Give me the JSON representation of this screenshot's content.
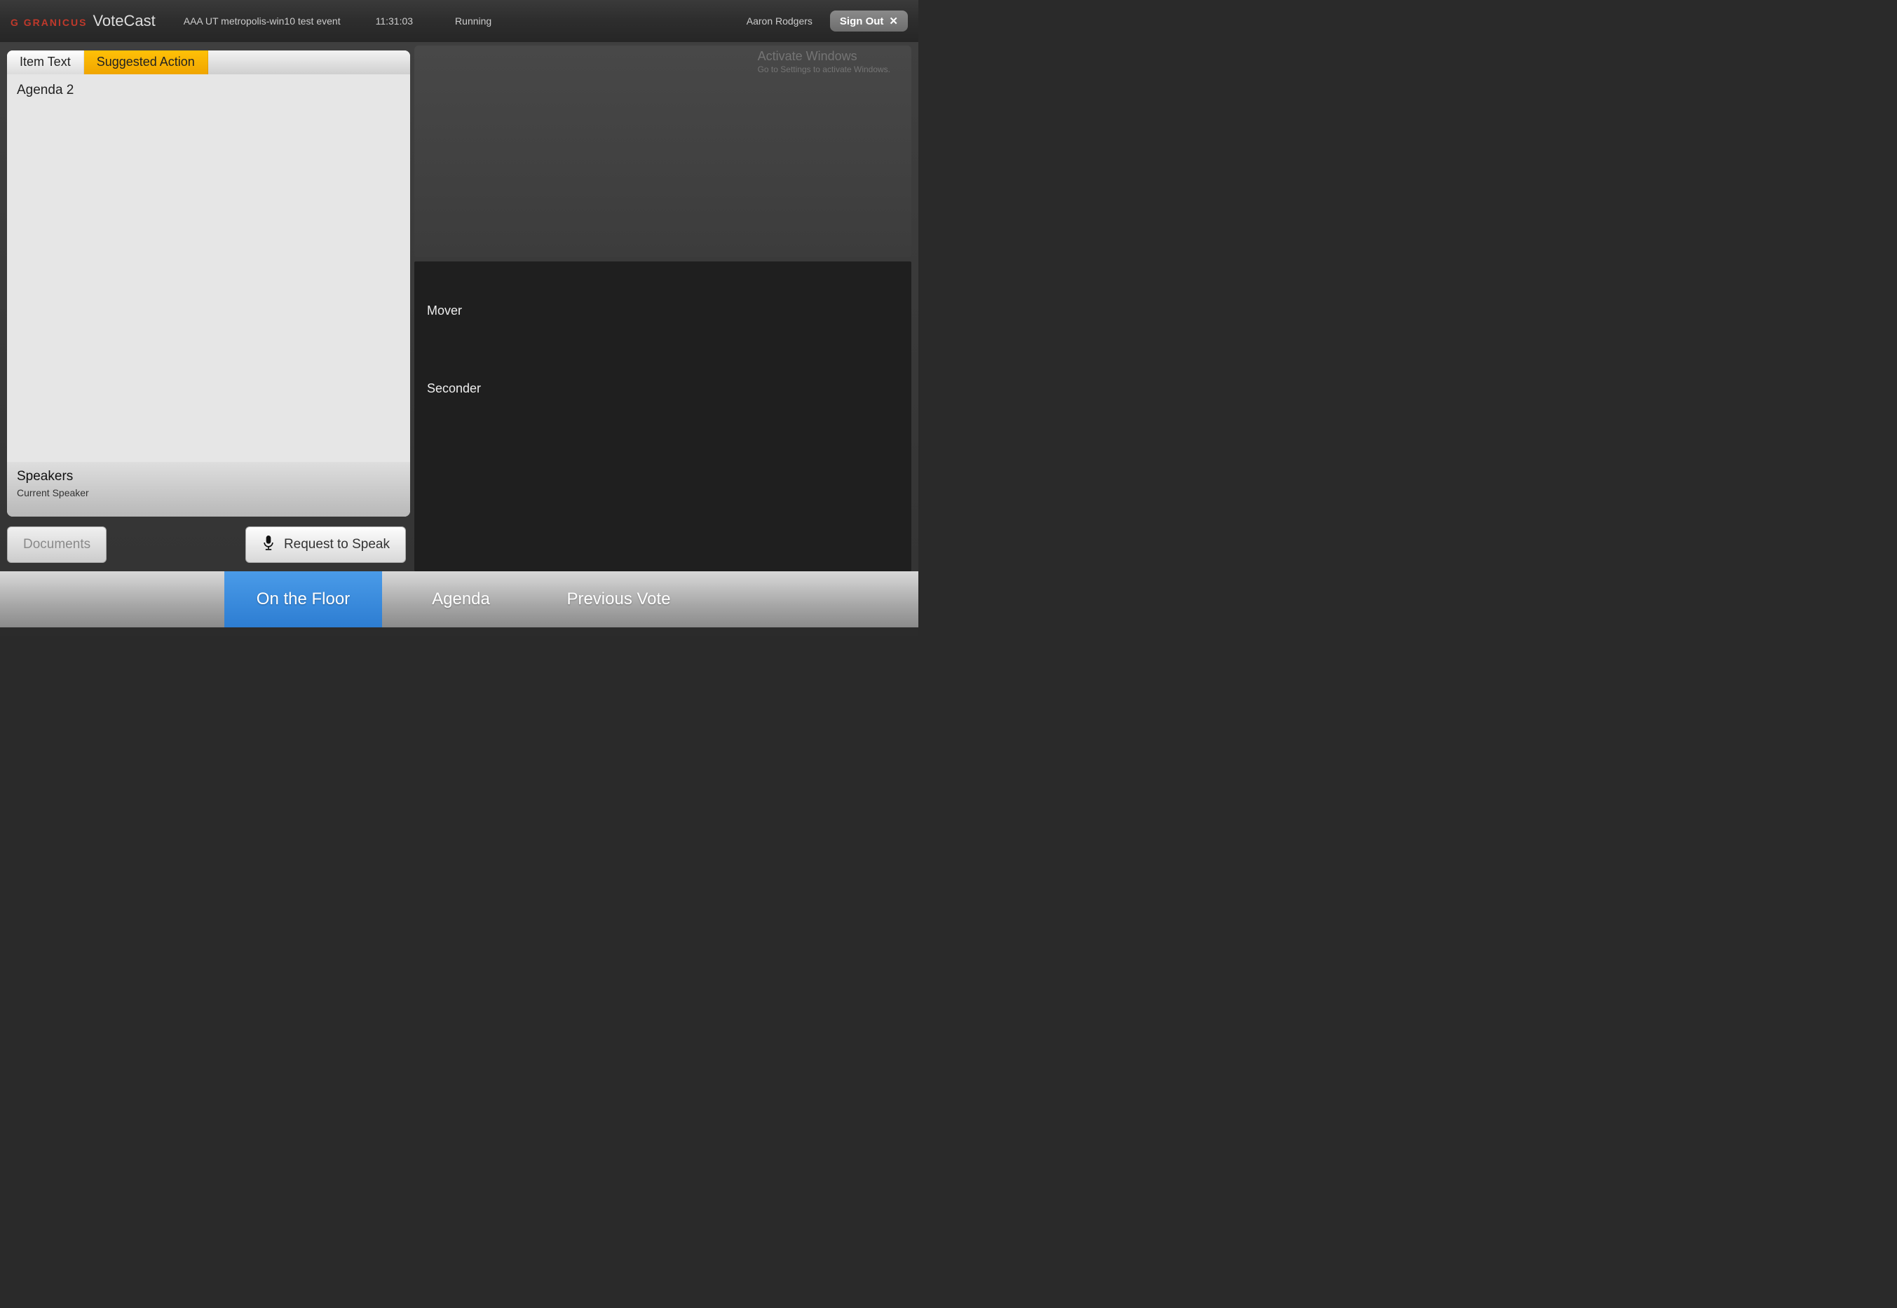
{
  "header": {
    "brand_small": "GRANICUS",
    "brand_name": "VoteCast",
    "event": "AAA UT metropolis-win10 test event",
    "time": "11:31:03",
    "status": "Running",
    "user": "Aaron Rodgers",
    "signout_label": "Sign Out"
  },
  "left": {
    "tabs": {
      "item_text": "Item Text",
      "suggested_action": "Suggested Action"
    },
    "item_body": "Agenda 2",
    "speakers_title": "Speakers",
    "speakers_sub": "Current Speaker",
    "documents_label": "Documents",
    "request_label": "Request to Speak"
  },
  "right": {
    "mover_label": "Mover",
    "seconder_label": "Seconder"
  },
  "nav": {
    "on_the_floor": "On the Floor",
    "agenda": "Agenda",
    "previous_vote": "Previous Vote"
  },
  "watermark": {
    "line1": "Activate Windows",
    "line2": "Go to Settings to activate Windows."
  }
}
